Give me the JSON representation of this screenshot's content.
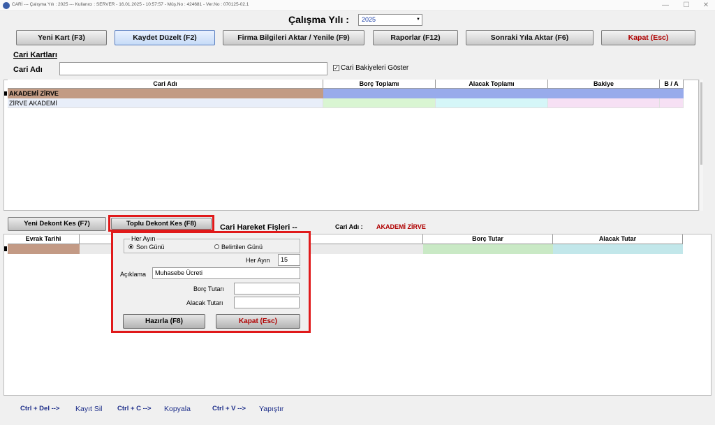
{
  "window": {
    "title": "CARİ  ---  Çalışma Yılı : 2025  ---  Kullanıcı : SERVER - 16.01.2025 - 10:57:57  - Müş.No : 424681 - Ver.No : 070125-02.1",
    "minimize": "—",
    "maximize": "☐",
    "close": "✕"
  },
  "year": {
    "label": "Çalışma Yılı :",
    "value": "2025"
  },
  "toolbar": {
    "new_card": "Yeni Kart (F3)",
    "save_edit": "Kaydet Düzelt (F2)",
    "firm_info": "Firma Bilgileri Aktar / Yenile (F9)",
    "reports": "Raporlar (F12)",
    "next_year": "Sonraki Yıla Aktar (F6)",
    "close": "Kapat (Esc)"
  },
  "cari": {
    "section_title": "Cari Kartları",
    "name_label": "Cari Adı",
    "name_value": "",
    "show_balances_label": "Cari Bakiyeleri Göster",
    "show_balances_checked": true
  },
  "upper_grid": {
    "columns": [
      "Cari Adı",
      "Borç Toplamı",
      "Alacak Toplamı",
      "Bakiye",
      "B / A"
    ],
    "rows": [
      {
        "name": "AKADEMİ ZİRVE",
        "borc": "",
        "alacak": "",
        "bakiye": "",
        "ba": ""
      },
      {
        "name": "ZİRVE AKADEMİ",
        "borc": "",
        "alacak": "",
        "bakiye": "",
        "ba": ""
      }
    ]
  },
  "middle": {
    "new_voucher": "Yeni Dekont Kes (F7)",
    "bulk_voucher": "Toplu Dekont Kes (F8)",
    "movements_title": "Cari Hareket Fişleri  --",
    "cari_label": "Cari Adı :",
    "cari_value": "AKADEMİ ZİRVE"
  },
  "lower_grid": {
    "columns": [
      "Evrak Tarihi",
      "Borç Tutar",
      "Alacak Tutar"
    ]
  },
  "popup": {
    "group_label": "Her Ayın",
    "radio_last_day": "Son Günü",
    "radio_specified_day": "Belirtilen Günü",
    "every_month_label": "Her Ayın",
    "every_month_value": "15",
    "description_label": "Açıklama",
    "description_value": "Muhasebe Ücreti",
    "debit_label": "Borç Tutarı",
    "debit_value": "",
    "credit_label": "Alacak Tutarı",
    "credit_value": "",
    "prepare_button": "Hazırla (F8)",
    "close_button": "Kapat (Esc)"
  },
  "footer": {
    "del_key": "Ctrl + Del -->",
    "del_action": "Kayıt Sil",
    "copy_key": "Ctrl + C -->",
    "copy_action": "Kopyala",
    "paste_key": "Ctrl + V -->",
    "paste_action": "Yapıştır"
  },
  "colors": {
    "row_selected_name": "#c29b84",
    "row_selected_rest": "#98abeb",
    "row_borc": "#d9f5d2",
    "row_alacak": "#d5f6f8",
    "row_bakiye": "#f6e0f4",
    "row2_name": "#e8eef9",
    "lower_evrak": "#c39a85",
    "lower_borc": "#c9e9c5",
    "lower_alacak": "#c2e7ea",
    "highlight": "#e0191a",
    "close_text": "#b00000"
  }
}
